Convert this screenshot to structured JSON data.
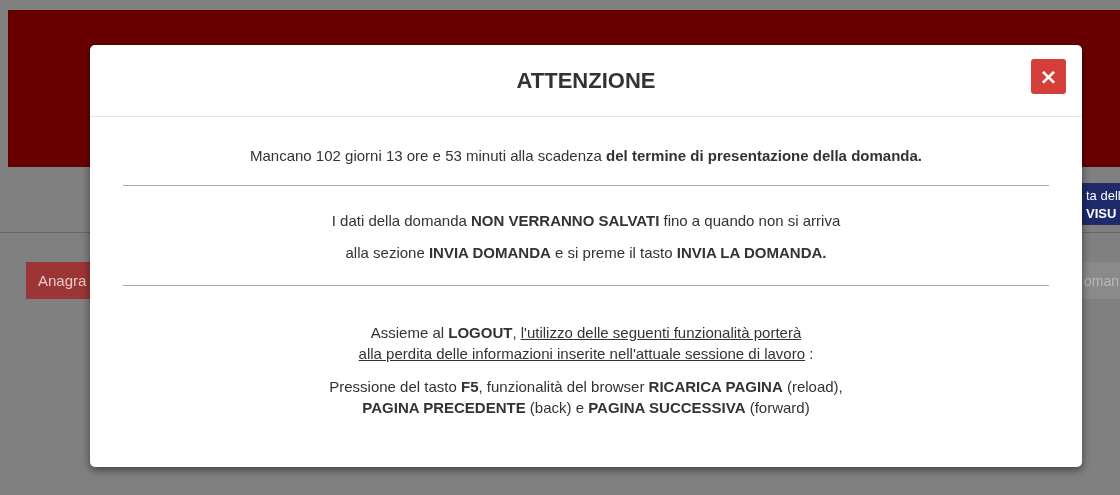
{
  "background": {
    "nav_button": "Anagra",
    "info_box": [
      "ta dell",
      "VISU"
    ],
    "right_button": "oman"
  },
  "modal": {
    "title": "ATTENZIONE",
    "close_icon": "×",
    "sections": [
      {
        "lines": [
          [
            {
              "text": "Mancano 102 giorni 13 ore e 53 minuti alla scadenza  **del termine di presentazione della domanda.**",
              "underline": false
            }
          ]
        ]
      },
      {
        "lines": [
          [
            {
              "text": "I dati della domanda **NON VERRANNO SALVATI** fino a quando non si arriva",
              "underline": false
            }
          ],
          [
            {
              "text": "alla sezione **INVIA DOMANDA** e si preme il tasto **INVIA LA DOMANDA.**",
              "underline": false
            }
          ]
        ]
      },
      {
        "lines": [
          [
            {
              "text": "Assieme al **LOGOUT**, ",
              "underline": false
            },
            {
              "text": "l'utilizzo delle seguenti funzionalità porterà",
              "underline": true
            }
          ],
          [
            {
              "text": "alla perdita delle informazioni inserite nell'attuale sessione di lavoro",
              "underline": true
            },
            {
              "text": " :",
              "underline": false
            }
          ],
          [
            {
              "text": "Pressione del tasto **F5**, funzionalità del browser **RICARICA PAGINA** (reload),",
              "underline": false
            }
          ],
          [
            {
              "text": "**PAGINA PRECEDENTE** (back) e **PAGINA SUCCESSIVA** (forward)",
              "underline": false
            }
          ]
        ]
      }
    ]
  }
}
